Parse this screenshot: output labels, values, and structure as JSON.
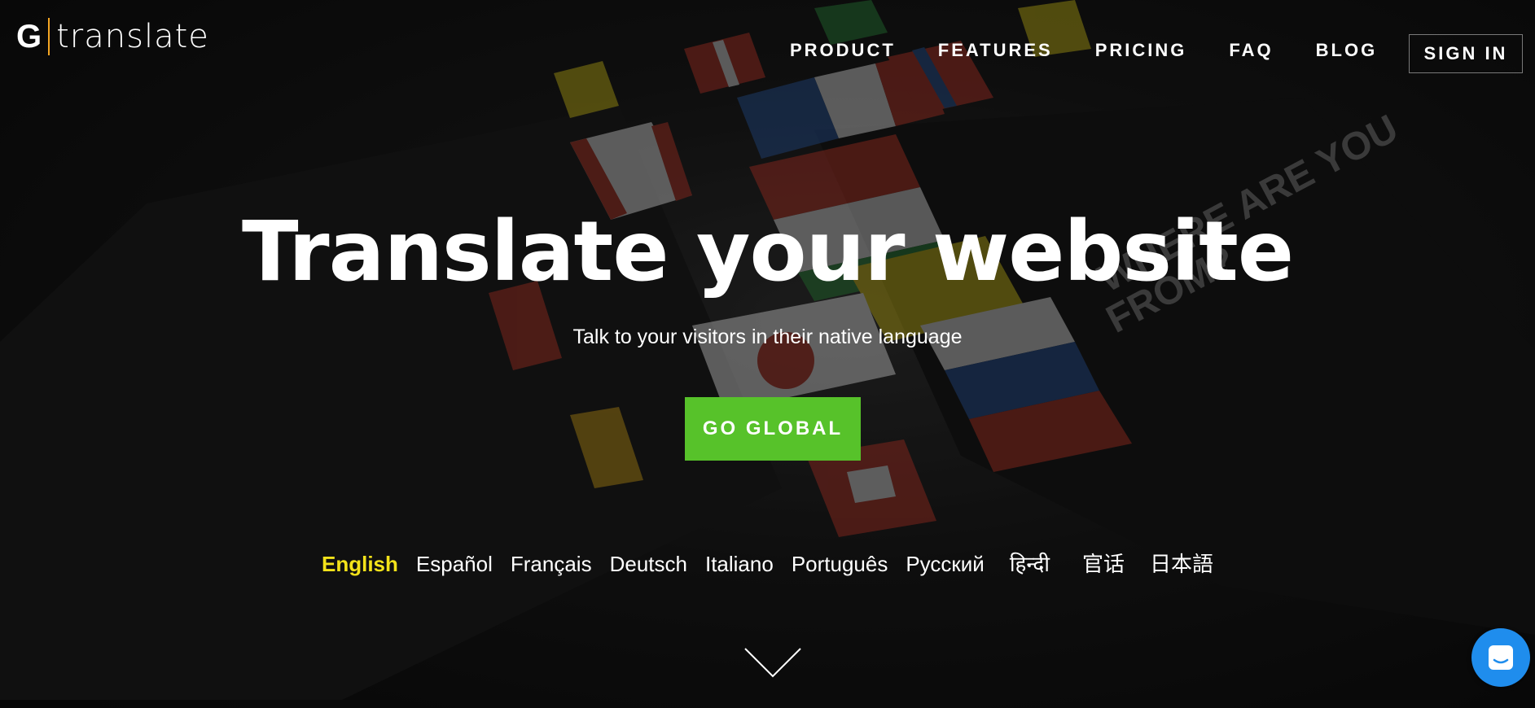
{
  "brand": {
    "logo_letter": "G",
    "logo_text": "translate",
    "accent_color": "#f5a623"
  },
  "nav": {
    "items": [
      {
        "label": "PRODUCT"
      },
      {
        "label": "FEATURES"
      },
      {
        "label": "PRICING"
      },
      {
        "label": "FAQ"
      },
      {
        "label": "BLOG"
      }
    ],
    "sign_in": "SIGN IN"
  },
  "hero": {
    "title": "Translate your website",
    "subtitle": "Talk to your visitors in their native language",
    "cta_label": "GO GLOBAL",
    "cta_color": "#57c22a"
  },
  "languages": {
    "items": [
      {
        "label": "English",
        "active": true
      },
      {
        "label": "Español"
      },
      {
        "label": "Français"
      },
      {
        "label": "Deutsch"
      },
      {
        "label": "Italiano"
      },
      {
        "label": "Português"
      },
      {
        "label": "Русский"
      },
      {
        "label": "हिन्दी"
      },
      {
        "label": "官话"
      },
      {
        "label": "日本語"
      }
    ],
    "active_color": "#f3e21a"
  },
  "icons": {
    "scroll": "chevron-down-icon",
    "chat": "chat-icon",
    "chat_color": "#1f8ded"
  }
}
